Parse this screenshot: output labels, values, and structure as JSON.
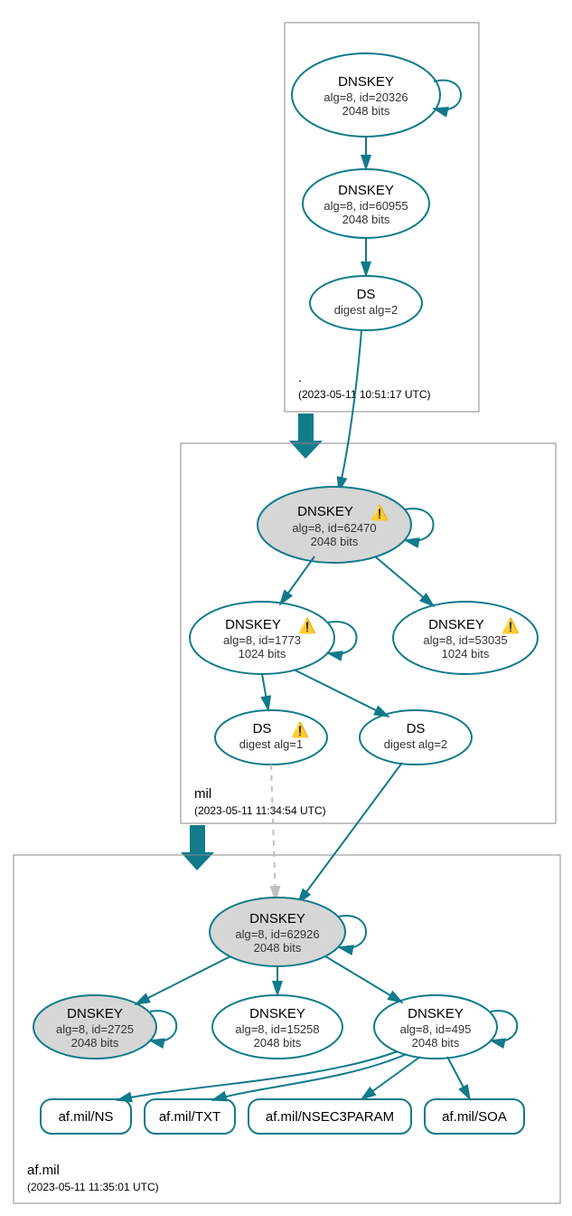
{
  "zones": {
    "root": {
      "name": ".",
      "ts": "(2023-05-11 10:51:17 UTC)"
    },
    "mil": {
      "name": "mil",
      "ts": "(2023-05-11 11:34:54 UTC)"
    },
    "afmil": {
      "name": "af.mil",
      "ts": "(2023-05-11 11:35:01 UTC)"
    }
  },
  "nodes": {
    "root_ksk": {
      "title": "DNSKEY",
      "l2": "alg=8, id=20326",
      "l3": "2048 bits"
    },
    "root_zsk": {
      "title": "DNSKEY",
      "l2": "alg=8, id=60955",
      "l3": "2048 bits"
    },
    "root_ds": {
      "title": "DS",
      "l2": "digest alg=2"
    },
    "mil_ksk": {
      "title": "DNSKEY",
      "l2": "alg=8, id=62470",
      "l3": "2048 bits",
      "warn": true
    },
    "mil_zsk1": {
      "title": "DNSKEY",
      "l2": "alg=8, id=1773",
      "l3": "1024 bits",
      "warn": true
    },
    "mil_zsk2": {
      "title": "DNSKEY",
      "l2": "alg=8, id=53035",
      "l3": "1024 bits",
      "warn": true
    },
    "mil_ds1": {
      "title": "DS",
      "l2": "digest alg=1",
      "warn": true
    },
    "mil_ds2": {
      "title": "DS",
      "l2": "digest alg=2"
    },
    "af_ksk": {
      "title": "DNSKEY",
      "l2": "alg=8, id=62926",
      "l3": "2048 bits"
    },
    "af_k1": {
      "title": "DNSKEY",
      "l2": "alg=8, id=2725",
      "l3": "2048 bits"
    },
    "af_k2": {
      "title": "DNSKEY",
      "l2": "alg=8, id=15258",
      "l3": "2048 bits"
    },
    "af_k3": {
      "title": "DNSKEY",
      "l2": "alg=8, id=495",
      "l3": "2048 bits"
    }
  },
  "rrsets": {
    "ns": "af.mil/NS",
    "txt": "af.mil/TXT",
    "nsec": "af.mil/NSEC3PARAM",
    "soa": "af.mil/SOA"
  },
  "warn_glyph": "⚠️"
}
